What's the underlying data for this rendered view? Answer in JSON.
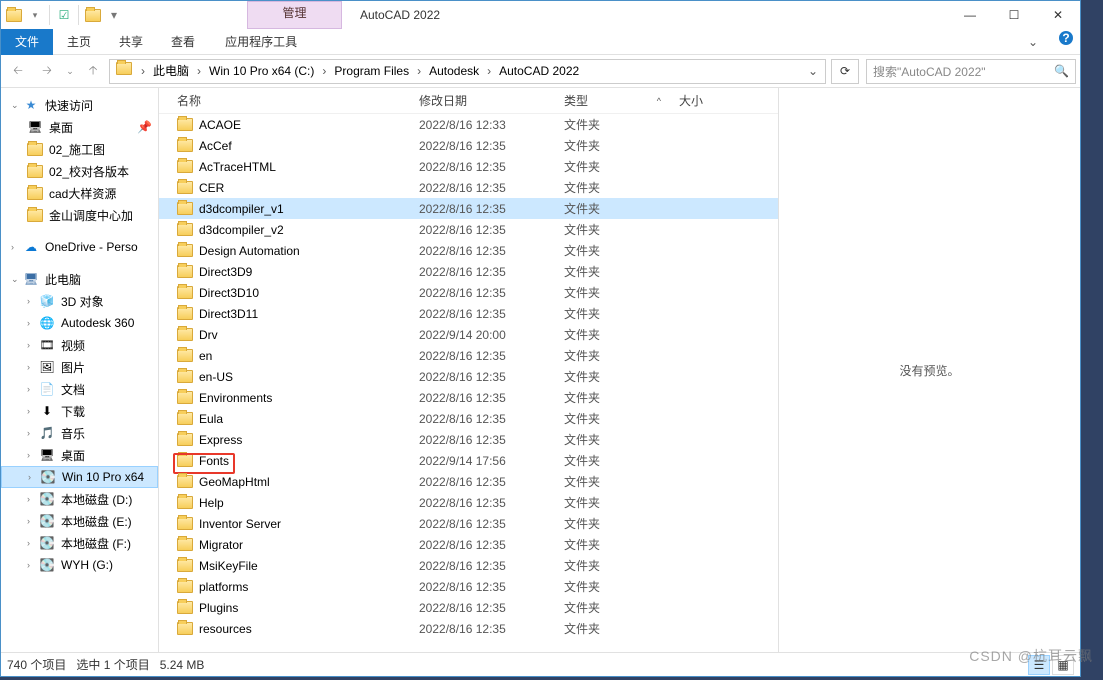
{
  "window": {
    "ctxtab": "管理",
    "title": "AutoCAD 2022"
  },
  "ribbon": {
    "file": "文件",
    "tabs": [
      "主页",
      "共享",
      "查看"
    ],
    "ctxtab": "应用程序工具"
  },
  "address": {
    "crumbs": [
      "此电脑",
      "Win 10 Pro x64 (C:)",
      "Program Files",
      "Autodesk",
      "AutoCAD 2022"
    ],
    "search_placeholder": "搜索\"AutoCAD 2022\""
  },
  "nav": {
    "quick": {
      "label": "快速访问"
    },
    "quick_items": [
      {
        "label": "桌面",
        "icon": "desktop",
        "pinned": true
      },
      {
        "label": "02_施工图",
        "icon": "folder"
      },
      {
        "label": "02_校对各版本",
        "icon": "folder"
      },
      {
        "label": "cad大样资源",
        "icon": "folder"
      },
      {
        "label": "金山调度中心加",
        "icon": "folder"
      }
    ],
    "onedrive": {
      "label": "OneDrive - Perso"
    },
    "pc": {
      "label": "此电脑"
    },
    "pc_items": [
      {
        "label": "3D 对象",
        "icon": "3d"
      },
      {
        "label": "Autodesk 360",
        "icon": "a360"
      },
      {
        "label": "视频",
        "icon": "video"
      },
      {
        "label": "图片",
        "icon": "pic"
      },
      {
        "label": "文档",
        "icon": "doc"
      },
      {
        "label": "下载",
        "icon": "dl"
      },
      {
        "label": "音乐",
        "icon": "music"
      },
      {
        "label": "桌面",
        "icon": "desktop"
      },
      {
        "label": "Win 10 Pro x64",
        "icon": "drive",
        "selected": true
      },
      {
        "label": "本地磁盘 (D:)",
        "icon": "drive"
      },
      {
        "label": "本地磁盘 (E:)",
        "icon": "drive"
      },
      {
        "label": "本地磁盘 (F:)",
        "icon": "drive"
      },
      {
        "label": "WYH (G:)",
        "icon": "drive"
      }
    ]
  },
  "columns": {
    "name": "名称",
    "date": "修改日期",
    "type": "类型",
    "size": "大小"
  },
  "files": [
    {
      "name": "ACAOE",
      "date": "2022/8/16 12:33",
      "type": "文件夹"
    },
    {
      "name": "AcCef",
      "date": "2022/8/16 12:35",
      "type": "文件夹"
    },
    {
      "name": "AcTraceHTML",
      "date": "2022/8/16 12:35",
      "type": "文件夹"
    },
    {
      "name": "CER",
      "date": "2022/8/16 12:35",
      "type": "文件夹"
    },
    {
      "name": "d3dcompiler_v1",
      "date": "2022/8/16 12:35",
      "type": "文件夹",
      "selected": true
    },
    {
      "name": "d3dcompiler_v2",
      "date": "2022/8/16 12:35",
      "type": "文件夹"
    },
    {
      "name": "Design Automation",
      "date": "2022/8/16 12:35",
      "type": "文件夹"
    },
    {
      "name": "Direct3D9",
      "date": "2022/8/16 12:35",
      "type": "文件夹"
    },
    {
      "name": "Direct3D10",
      "date": "2022/8/16 12:35",
      "type": "文件夹"
    },
    {
      "name": "Direct3D11",
      "date": "2022/8/16 12:35",
      "type": "文件夹"
    },
    {
      "name": "Drv",
      "date": "2022/9/14 20:00",
      "type": "文件夹"
    },
    {
      "name": "en",
      "date": "2022/8/16 12:35",
      "type": "文件夹"
    },
    {
      "name": "en-US",
      "date": "2022/8/16 12:35",
      "type": "文件夹"
    },
    {
      "name": "Environments",
      "date": "2022/8/16 12:35",
      "type": "文件夹"
    },
    {
      "name": "Eula",
      "date": "2022/8/16 12:35",
      "type": "文件夹"
    },
    {
      "name": "Express",
      "date": "2022/8/16 12:35",
      "type": "文件夹"
    },
    {
      "name": "Fonts",
      "date": "2022/9/14 17:56",
      "type": "文件夹",
      "highlighted": true
    },
    {
      "name": "GeoMapHtml",
      "date": "2022/8/16 12:35",
      "type": "文件夹"
    },
    {
      "name": "Help",
      "date": "2022/8/16 12:35",
      "type": "文件夹"
    },
    {
      "name": "Inventor Server",
      "date": "2022/8/16 12:35",
      "type": "文件夹"
    },
    {
      "name": "Migrator",
      "date": "2022/8/16 12:35",
      "type": "文件夹"
    },
    {
      "name": "MsiKeyFile",
      "date": "2022/8/16 12:35",
      "type": "文件夹"
    },
    {
      "name": "platforms",
      "date": "2022/8/16 12:35",
      "type": "文件夹"
    },
    {
      "name": "Plugins",
      "date": "2022/8/16 12:35",
      "type": "文件夹"
    },
    {
      "name": "resources",
      "date": "2022/8/16 12:35",
      "type": "文件夹"
    }
  ],
  "preview": {
    "empty": "没有预览。"
  },
  "status": {
    "count": "740 个项目",
    "selected": "选中 1 个项目",
    "size": "5.24 MB"
  },
  "watermark": "CSDN @杭耳云飘"
}
